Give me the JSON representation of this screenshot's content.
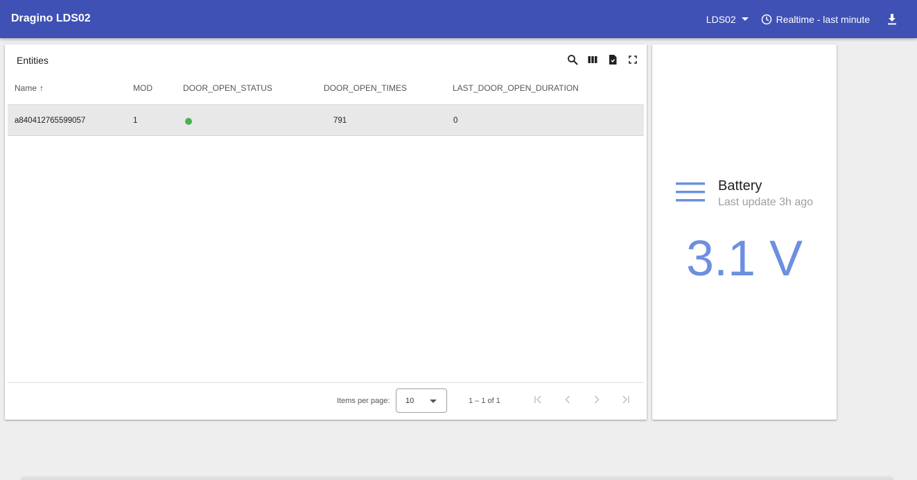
{
  "app": {
    "title": "Dragino LDS02"
  },
  "topbar": {
    "device": "LDS02",
    "time_window": "Realtime - last minute",
    "icons": {
      "time": "clock-icon",
      "download": "download-icon"
    }
  },
  "entities": {
    "title": "Entities",
    "toolbar_icons": [
      "search-icon",
      "columns-icon",
      "export-icon",
      "fullscreen-icon"
    ],
    "columns": [
      "Name",
      "MOD",
      "DOOR_OPEN_STATUS",
      "DOOR_OPEN_TIMES",
      "LAST_DOOR_OPEN_DURATION"
    ],
    "sort_indicator": "↑",
    "rows": [
      {
        "name": "a840412765599057",
        "mod": "1",
        "door_open_status_color": "#4caf50",
        "door_open_times": "791",
        "last_door_open_duration": "0"
      }
    ],
    "pagination": {
      "items_per_page_label": "Items per page:",
      "items_per_page": "10",
      "range": "1 – 1 of 1"
    }
  },
  "battery": {
    "title": "Battery",
    "subtitle": "Last update 3h ago",
    "value": "3.1 V",
    "accent_color": "#6d8fe0"
  },
  "colors": {
    "topbar": "#3f51b5",
    "background": "#eeeeee"
  }
}
